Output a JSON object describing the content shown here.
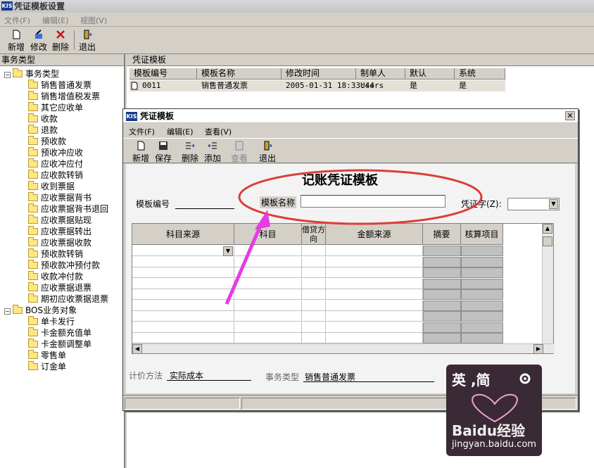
{
  "app": {
    "title": "凭证模板设置"
  },
  "menu": {
    "file": "文件(F)",
    "edit": "编辑(E)",
    "view": "视图(V)"
  },
  "toolbar": {
    "new": "新增",
    "modify": "修改",
    "delete": "删除",
    "exit": "退出"
  },
  "left_pane": {
    "header": "事务类型",
    "root": "事务类型",
    "items": [
      "销售普通发票",
      "销售增值税发票",
      "其它应收单",
      "收款",
      "退款",
      "预收款",
      "预收冲应收",
      "应收冲应付",
      "应收款转销",
      "收到票据",
      "应收票据背书",
      "应收票据背书退回",
      "应收票据贴现",
      "应收票据转出",
      "应收票据收款",
      "预收款转销",
      "预收款冲预付款",
      "收款冲付款",
      "应收票据退票",
      "期初应收票据退票"
    ],
    "root2": "BOS业务对象",
    "items2": [
      "单卡发行",
      "卡金额充值单",
      "卡金额调整单",
      "零售单",
      "订金单"
    ]
  },
  "right_pane": {
    "header": "凭证模板",
    "columns": [
      "模板编号",
      "模板名称",
      "修改时间",
      "制单人",
      "默认",
      "系统"
    ],
    "rows": [
      [
        "0011",
        "销售普通发票",
        "2005-01-31 18:33:44",
        "Users",
        "是",
        "是"
      ]
    ]
  },
  "dialog": {
    "title": "凭证模板",
    "close": "✕",
    "menu": {
      "file": "文件(F)",
      "edit": "编辑(E)",
      "view": "查看(V)"
    },
    "toolbar": {
      "new": "新增",
      "save": "保存",
      "delete": "删除",
      "add": "添加",
      "view": "查看",
      "exit": "退出"
    },
    "doc_title": "记账凭证模板",
    "template_no_label": "模板编号",
    "template_name_label": "模板名称",
    "template_name_value": "",
    "voucher_word_label": "凭证字(Z):",
    "table_headers": [
      "科目来源",
      "科目",
      "借贷方向",
      "金额来源",
      "摘要",
      "核算项目"
    ],
    "pricing_label": "计价方法",
    "pricing_value": "实际成本",
    "biz_type_label": "事务类型",
    "biz_type_value": "销售普通发票"
  },
  "watermark": {
    "line1": "英 ,简",
    "brand": "Baidu经验",
    "url": "jingyan.baidu.com"
  },
  "colors": {
    "arrow": "#e63ce0",
    "ellipse": "#d9403a",
    "title_brand": "#1a3b8c"
  }
}
